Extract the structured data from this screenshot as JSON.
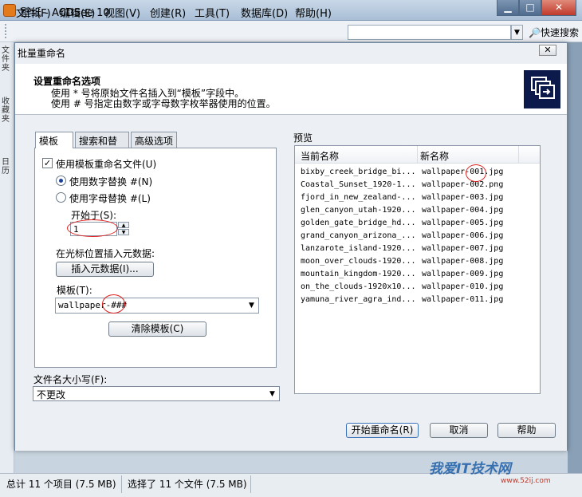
{
  "window": {
    "title": "壁纸 - ACDSee 10",
    "buttons": [
      "▁",
      "□",
      "✕"
    ]
  },
  "menubar": {
    "items": [
      "文件(F)",
      "编辑(E)",
      "视图(V)",
      "创建(R)",
      "工具(T)",
      "数据库(D)",
      "帮助(H)"
    ],
    "search_value": "",
    "quick_search": "快速搜索"
  },
  "sidetabs": [
    "文件夹",
    "收藏夹",
    "日历"
  ],
  "dialog": {
    "title": "批量重命名",
    "close": "✕",
    "header": {
      "title": "设置重命名选项",
      "line1": "使用 * 号将原始文件名插入到“模板”字段中。",
      "line2": "使用 # 号指定由数字或字母数字枚举器使用的位置。"
    },
    "tabs": [
      "模板",
      "搜索和替换",
      "高级选项"
    ],
    "template_panel": {
      "use_template_label": "使用模板重命名文件(U)",
      "use_template_checked": "✓",
      "radio_numeric": "使用数字替换 #(N)",
      "radio_alpha": "使用字母替换 #(L)",
      "start_at_label": "开始于(S):",
      "start_at_value": "1",
      "insert_meta_label": "在光标位置插入元数据:",
      "insert_meta_button": "插入元数据(I)...",
      "template_label": "模板(T):",
      "template_value": "wallpaper-###",
      "clear_template_button": "清除模板(C)"
    },
    "case_label": "文件名大小写(F):",
    "case_value": "不更改",
    "preview": {
      "label": "预览",
      "col_current": "当前名称",
      "col_new": "新名称",
      "rows": [
        {
          "current": "bixby_creek_bridge_bi...",
          "new": "wallpaper-001.jpg"
        },
        {
          "current": "Coastal_Sunset_1920-1...",
          "new": "wallpaper-002.png"
        },
        {
          "current": "fjord_in_new_zealand-...",
          "new": "wallpaper-003.jpg"
        },
        {
          "current": "glen_canyon_utah-1920...",
          "new": "wallpaper-004.jpg"
        },
        {
          "current": "golden_gate_bridge_hd...",
          "new": "wallpaper-005.jpg"
        },
        {
          "current": "grand_canyon_arizona_...",
          "new": "wallpaper-006.jpg"
        },
        {
          "current": "lanzarote_island-1920...",
          "new": "wallpaper-007.jpg"
        },
        {
          "current": "moon_over_clouds-1920...",
          "new": "wallpaper-008.jpg"
        },
        {
          "current": "mountain_kingdom-1920...",
          "new": "wallpaper-009.jpg"
        },
        {
          "current": "on_the_clouds-1920x10...",
          "new": "wallpaper-010.jpg"
        },
        {
          "current": "yamuna_river_agra_ind...",
          "new": "wallpaper-011.jpg"
        }
      ]
    },
    "buttons": {
      "start": "开始重命名(R)",
      "cancel": "取消",
      "help": "帮助"
    }
  },
  "statusbar": {
    "total": "总计 11 个项目 (7.5 MB)",
    "selected": "选择了 11 个文件 (7.5 MB)"
  },
  "watermark": {
    "text": "我爱IT技术网",
    "url": "www.52ij.com"
  }
}
